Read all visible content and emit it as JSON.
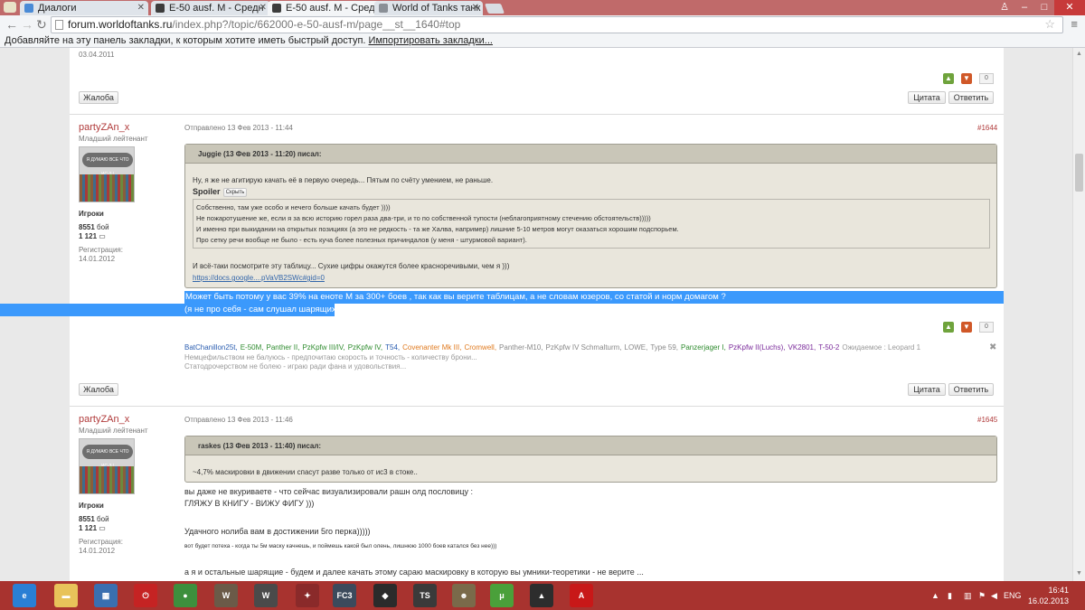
{
  "browser": {
    "tabs": [
      {
        "title": "Диалоги",
        "color": "#4a8bd6"
      },
      {
        "title": "E-50 ausf. M - Средн",
        "color": "#3c3c3c"
      },
      {
        "title": "E-50 ausf. M - Средн",
        "color": "#3c3c3c"
      },
      {
        "title": "World of Tanks танк",
        "color": "#8a8f96"
      }
    ],
    "window_controls": {
      "user": "♙",
      "min": "–",
      "max": "□",
      "close": "✕"
    },
    "url_host": "forum.worldoftanks.ru",
    "url_path": "/index.php?/topic/662000-e-50-ausf-m/page__st__1640#top",
    "bookmarks_text": "Добавляйте на эту панель закладки, к которым хотите иметь быстрый доступ.",
    "bookmarks_import": "Импортировать закладки..."
  },
  "forum": {
    "prev": {
      "date": "03.04.2011",
      "votes": "0",
      "report": "Жалоба",
      "quote": "Цитата",
      "reply": "Ответить"
    },
    "posts": [
      {
        "author": "partyZAn_x",
        "rank": "Младший лейтенант",
        "avatar_text": "Я ДУМАЮ ВСЕ ЧТО ИС-3 !",
        "group": "Игроки",
        "battles_num": "8551",
        "battles_label": "бой",
        "rep": "1 121",
        "reg_label": "Регистрация:",
        "reg_date": "14.01.2012",
        "sent": "Отправлено 13 Фев 2013 - 11:44",
        "number": "#1644",
        "quote_head": "Juggie (13 Фев 2013 - 11:20) писал:",
        "quote_line1": "Ну, я же не агитирую качать её в первую очередь... Пятым по счёту умением, не раньше.",
        "spoiler_label": "Spoiler",
        "spoiler_hide": "Скрыть",
        "spoiler_lines": [
          "Собственно, там уже особо и нечего больше качать будет ))))",
          "Не пожаротушение же, если я за всю историю горел раза два-три, и то по собственной тупости (неблагоприятному стечению обстоятельств)))))",
          "И именно при выкидании на открытых позициях (а это не редкость - та же Халва, например) лишние 5-10 метров могут оказаться хорошим подспорьем.",
          "Про сетку речи вообще не было - есть куча более полезных причиндалов (у меня - штурмовой вариант)."
        ],
        "quote_line2": "И всё-таки посмотрите эту таблицу... Сухие цифры окажутся более красноречивыми, чем я )))",
        "quote_link": "https://docs.google....pVaVB2SWc#gid=0",
        "reply_line1": "Может быть потому у вас 39% на еноте М за 300+ боев , так как вы верите таблицам, а не словам юзеров, со статой и норм домагом ?",
        "reply_line2": "(я не про себя - сам слушал шарящих)",
        "votes": "0",
        "report": "Жалоба",
        "quote_btn": "Цитата",
        "reply_btn": "Ответить",
        "sig_tanks": [
          {
            "name": "BatChanillon25t,",
            "color": "#2a5db0"
          },
          {
            "name": "E-50M,",
            "color": "#2e8b2e"
          },
          {
            "name": "Panther II,",
            "color": "#2e8b2e"
          },
          {
            "name": "PzKpfw III/IV,",
            "color": "#2e8b2e"
          },
          {
            "name": "PzKpfw IV,",
            "color": "#2e8b2e"
          },
          {
            "name": "T54,",
            "color": "#2a5db0"
          },
          {
            "name": "Covenanter Mk III,",
            "color": "#e07a1f"
          },
          {
            "name": "Cromwell,",
            "color": "#e07a1f"
          },
          {
            "name": "Panther-M10,",
            "color": "#888888"
          },
          {
            "name": "PzKpfw IV Schmalturm,",
            "color": "#888888"
          },
          {
            "name": "LOWE,",
            "color": "#888888"
          },
          {
            "name": "Type 59,",
            "color": "#888888"
          },
          {
            "name": "Panzerjager I,",
            "color": "#2e8b2e"
          },
          {
            "name": "PzKpfw II(Luchs),",
            "color": "#7a2a9a"
          },
          {
            "name": "VK2801,",
            "color": "#7a2a9a"
          },
          {
            "name": "T-50-2",
            "color": "#7a2a9a"
          },
          {
            "name": "Ожидаемое : Leopard 1",
            "color": "#999999"
          }
        ],
        "sig_line2": "Немцефильством не балуюсь - предпочитаю скорость и точность - количеству брони...",
        "sig_line3": "Статодрочерством не болею - играю ради фана и удовольствия..."
      },
      {
        "author": "partyZAn_x",
        "rank": "Младший лейтенант",
        "avatar_text": "Я ДУМАЮ ВСЕ ЧТО ИС-3 !",
        "group": "Игроки",
        "battles_num": "8551",
        "battles_label": "бой",
        "rep": "1 121",
        "reg_label": "Регистрация:",
        "reg_date": "14.01.2012",
        "sent": "Отправлено 13 Фев 2013 - 11:46",
        "number": "#1645",
        "quote_head": "raskes (13 Фев 2013 - 11:40) писал:",
        "quote_line1": "~4,7% маскировки в движении спасут разве только от ис3 в стоке..",
        "body_lines": [
          "вы даже не вкуриваете - что сейчас визуализировали рашн олд пословицу :",
          "ГЛЯЖУ В КНИГУ - ВИЖУ ФИГУ )))",
          "Удачного нолиба вам в достижении 5го перка)))))",
          "вот будет потеха - когда ты 5м маску качнешь, и поймешь какой был олень, лишнюю 1000 боев катался без нее)))",
          "а я и остальные шарящие - будем и далее качать этому сараю маскировку в которую вы умники-теоретики  - не верите ..."
        ]
      }
    ]
  },
  "taskbar": {
    "apps": [
      {
        "name": "ie",
        "label": "e",
        "color": "#2a7fd4"
      },
      {
        "name": "explorer",
        "label": "▬",
        "color": "#e8c35a"
      },
      {
        "name": "control-panel",
        "label": "▦",
        "color": "#3a6fb0"
      },
      {
        "name": "power",
        "label": "⏻",
        "color": "#c52323"
      },
      {
        "name": "chrome",
        "label": "●",
        "color": "#3d8f3d"
      },
      {
        "name": "wot",
        "label": "W",
        "color": "#6b5a48"
      },
      {
        "name": "wot-xvm",
        "label": "W",
        "color": "#4a4a4a"
      },
      {
        "name": "game1",
        "label": "✦",
        "color": "#8a2a2a"
      },
      {
        "name": "fc3",
        "label": "FC3",
        "color": "#3c4a5c"
      },
      {
        "name": "shield",
        "label": "◆",
        "color": "#2b2b2b"
      },
      {
        "name": "ts",
        "label": "TS",
        "color": "#3a3a3a"
      },
      {
        "name": "avatar-app",
        "label": "☻",
        "color": "#7a6a4a"
      },
      {
        "name": "utorrent",
        "label": "μ",
        "color": "#4aa03a"
      },
      {
        "name": "aimp",
        "label": "▲",
        "color": "#2d2d2d"
      },
      {
        "name": "acrobat",
        "label": "A",
        "color": "#c81818"
      }
    ],
    "lang": "ENG",
    "time": "16:41",
    "date": "16.02.2013"
  }
}
